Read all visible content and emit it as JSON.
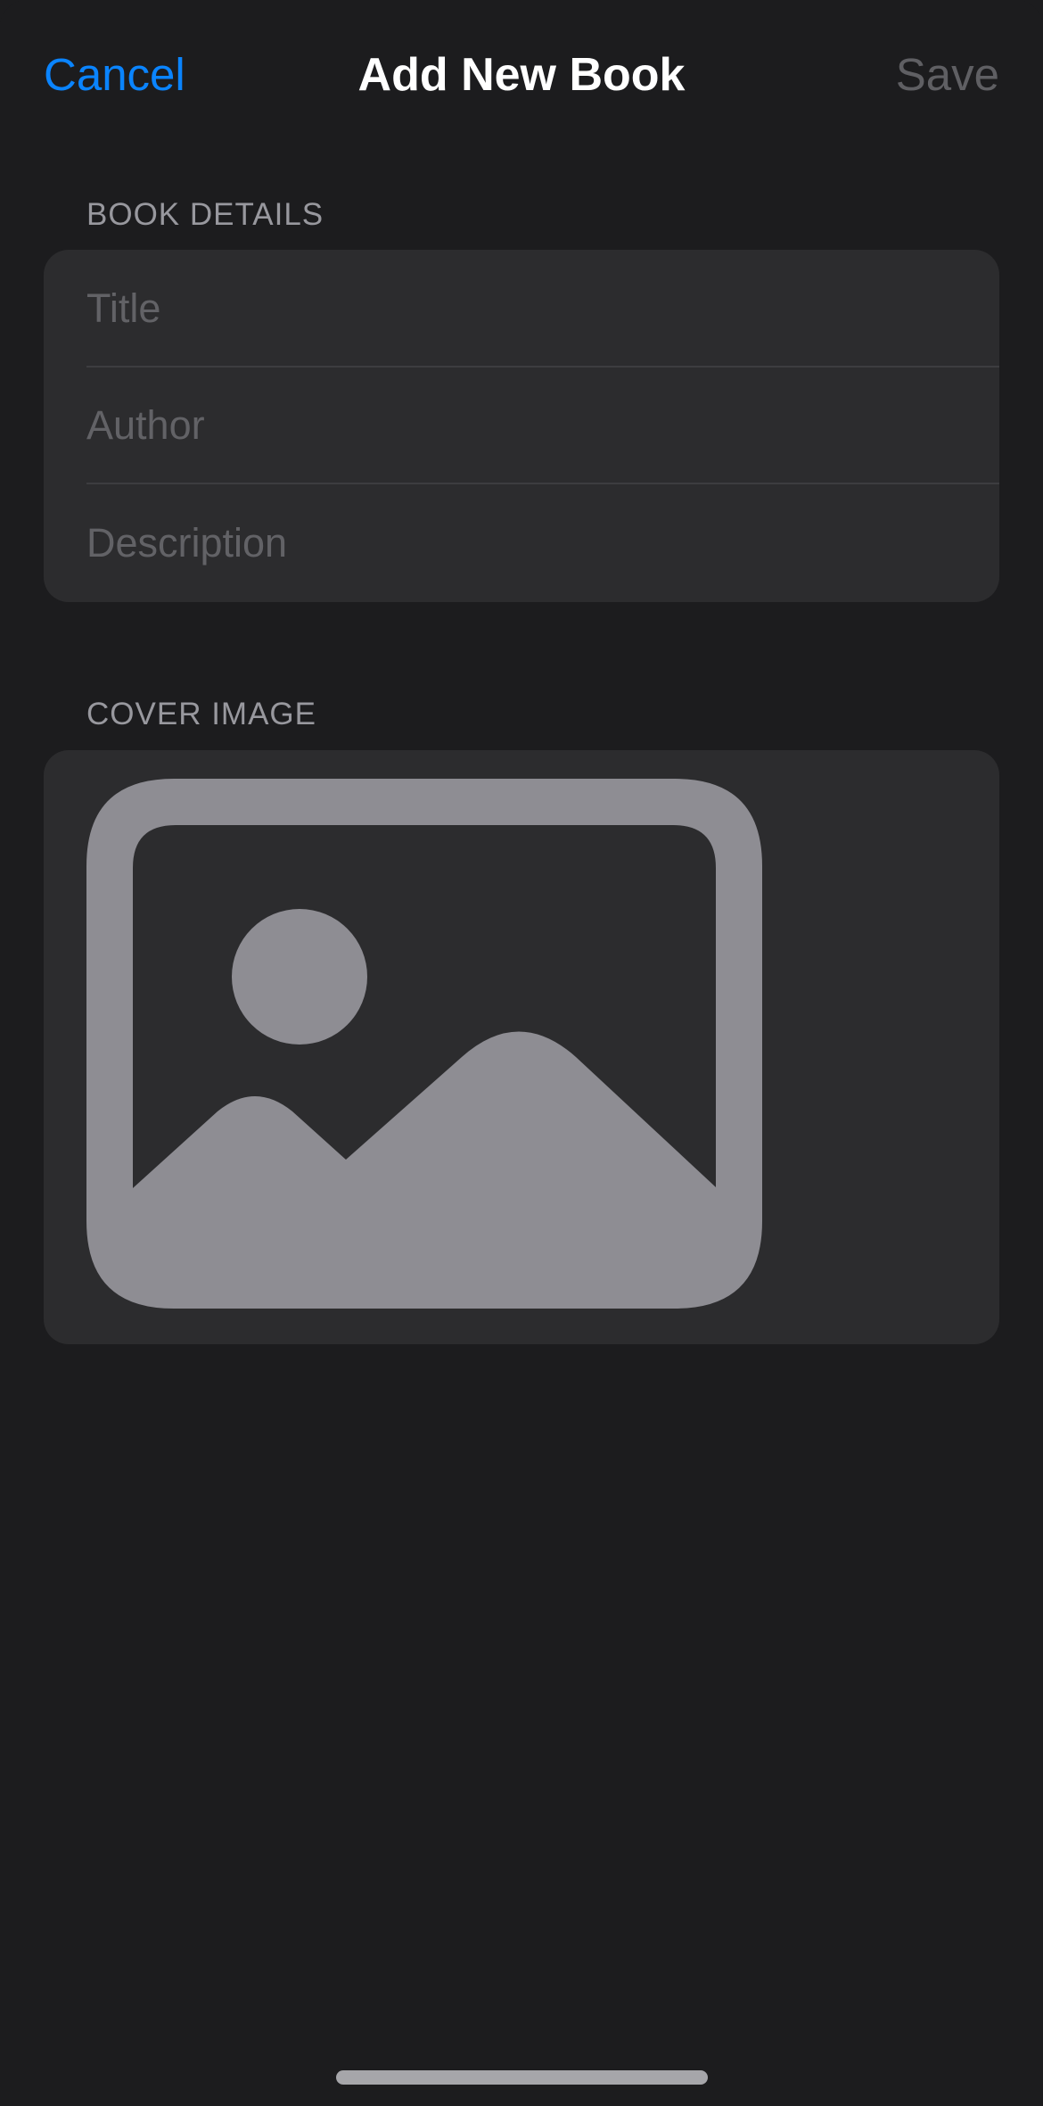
{
  "nav": {
    "cancel_label": "Cancel",
    "title": "Add New Book",
    "save_label": "Save"
  },
  "book_details": {
    "header": "BOOK DETAILS",
    "fields": {
      "title_placeholder": "Title",
      "author_placeholder": "Author",
      "description_placeholder": "Description"
    }
  },
  "cover_image": {
    "header": "COVER IMAGE",
    "icon": "photo-placeholder-icon"
  },
  "colors": {
    "background": "#1c1c1e",
    "group_background": "#2c2c2e",
    "accent": "#0a84ff",
    "disabled_text": "#5f5f63",
    "secondary_text": "#98989e",
    "icon_fill": "#8e8d93"
  }
}
